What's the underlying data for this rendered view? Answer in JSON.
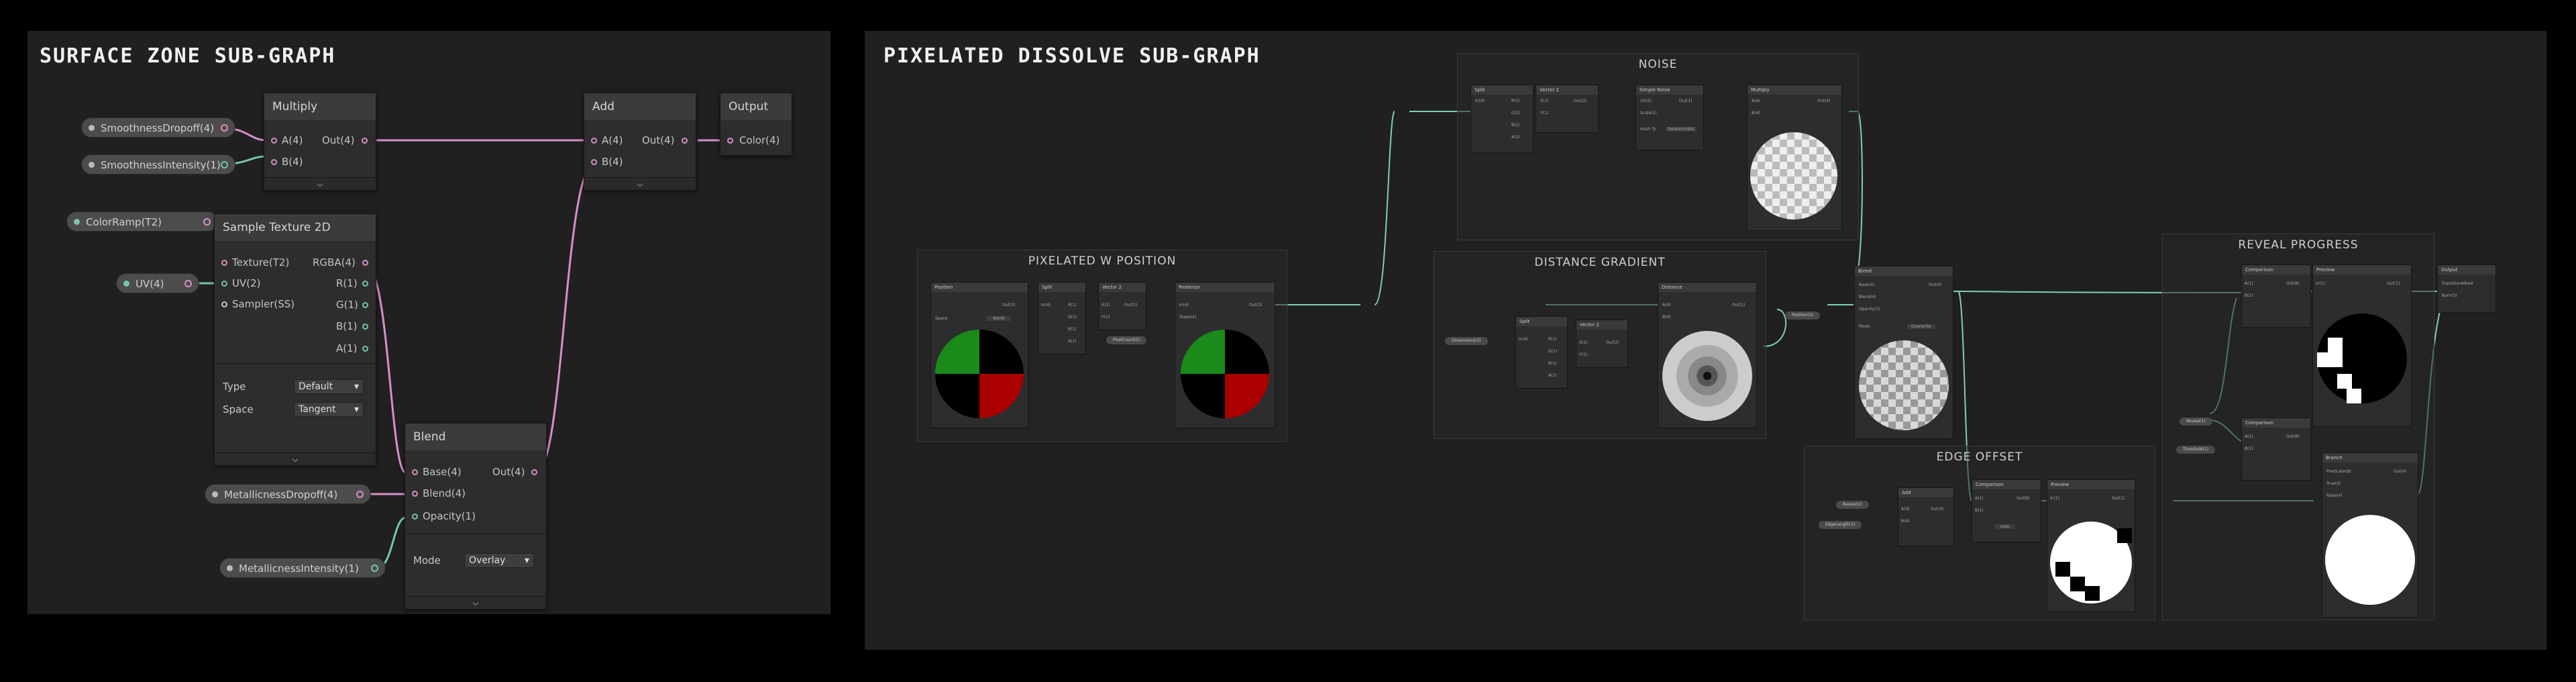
{
  "left_panel": {
    "title": "SURFACE ZONE SUB-GRAPH",
    "properties": {
      "smoothness_dropoff": "SmoothnessDropoff(4)",
      "smoothness_intensity": "SmoothnessIntensity(1)",
      "color_ramp": "ColorRamp(T2)",
      "uv": "UV(4)",
      "metallicness_dropoff": "MetallicnessDropoff(4)",
      "metallicness_intensity": "MetallicnessIntensity(1)"
    },
    "multiply": {
      "title": "Multiply",
      "in_a": "A(4)",
      "in_b": "B(4)",
      "out": "Out(4)"
    },
    "add": {
      "title": "Add",
      "in_a": "A(4)",
      "in_b": "B(4)",
      "out": "Out(4)"
    },
    "output": {
      "title": "Output",
      "in": "Color(4)"
    },
    "sample_texture": {
      "title": "Sample Texture 2D",
      "in_texture": "Texture(T2)",
      "in_uv": "UV(2)",
      "in_sampler": "Sampler(SS)",
      "out_rgba": "RGBA(4)",
      "out_r": "R(1)",
      "out_g": "G(1)",
      "out_b": "B(1)",
      "out_a": "A(1)",
      "type_label": "Type",
      "type_value": "Default",
      "space_label": "Space",
      "space_value": "Tangent"
    },
    "blend": {
      "title": "Blend",
      "in_base": "Base(4)",
      "in_blend": "Blend(4)",
      "in_opacity": "Opacity(1)",
      "out": "Out(4)",
      "mode_label": "Mode",
      "mode_value": "Overlay"
    }
  },
  "right_panel": {
    "title": "PIXELATED DISSOLVE SUB-GRAPH",
    "groups": {
      "noise": "NOISE",
      "pixelated": "PIXELATED W POSITION",
      "distance": "DISTANCE GRADIENT",
      "edge": "EDGE OFFSET",
      "reveal": "REVEAL PROGRESS"
    },
    "nodes": {
      "split": "Split",
      "vector2": "Vector 2",
      "simple_noise": "Simple Noise",
      "multiply": "Multiply",
      "position": "Position",
      "posterize": "Posterize",
      "distance": "Distance",
      "blend": "Blend",
      "add": "Add",
      "comparison": "Comparison",
      "preview": "Preview",
      "branch": "Branch",
      "output": "Output",
      "space_label": "Space",
      "space_value": "World",
      "mode_label": "Mode",
      "mode_value": "Overwrite",
      "hash_label": "Hash Ty",
      "hash_value": "Deterministic",
      "less_label": "Less"
    },
    "ports": {
      "uv": "UV(2)",
      "scale": "Scale(1)",
      "out1": "Out(1)",
      "out2": "Out(2)",
      "out3": "Out(3)",
      "out4": "Out(4)",
      "in4": "In(4)",
      "steps": "Steps(4)",
      "r": "R(1)",
      "g": "G(1)",
      "b": "B(1)",
      "a": "A(1)",
      "x": "X(1)",
      "y": "Y(1)",
      "a1": "A(1)",
      "b1": "B(1)",
      "a4": "A(4)",
      "b4": "B(4)",
      "base": "Base(4)",
      "blend4": "Blend(4)",
      "opacity": "Opacity(1)",
      "in1": "In(1)",
      "predicate": "Predicate(B)",
      "true": "True(4)",
      "false": "False(4)",
      "out_b": "Out(B)",
      "tex_color": "TransitionAlbed",
      "burn_color": "Burn(3)"
    },
    "props": {
      "pixel_count": "PixelCount(2)",
      "dimensions": "Dimensions(3)",
      "position": "Position(3)",
      "reveal": "Reveal(1)",
      "edge_length": "EdgeLength(1)",
      "reveal2": "Reveal(1)",
      "threshold": "Threshold(1)"
    }
  }
}
